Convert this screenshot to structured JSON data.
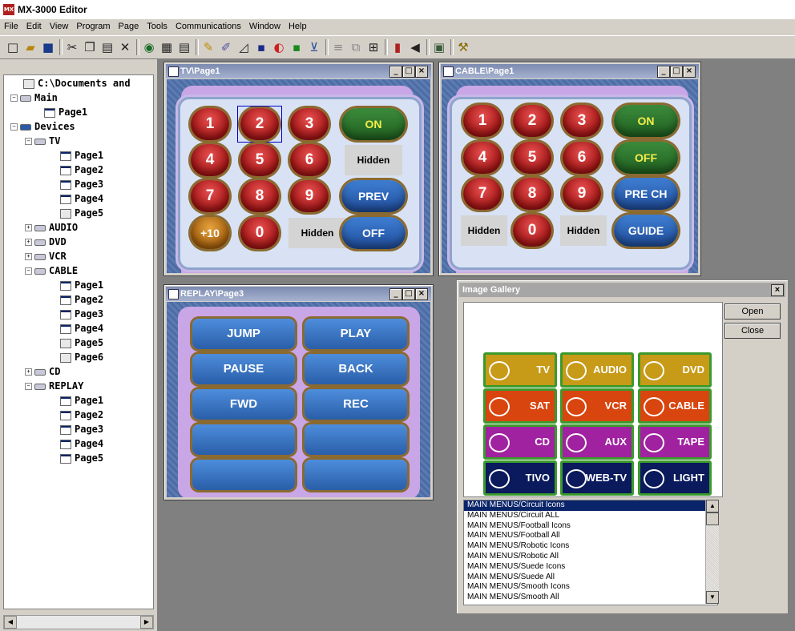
{
  "app": {
    "title": "MX-3000 Editor",
    "icon_text": "MX"
  },
  "menu": [
    "File",
    "Edit",
    "View",
    "Program",
    "Page",
    "Tools",
    "Communications",
    "Window",
    "Help"
  ],
  "tree": {
    "root": "C:\\Documents and",
    "main": "Main",
    "main_page": "Page1",
    "devices": "Devices",
    "tv": "TV",
    "tv_pages": [
      "Page1",
      "Page2",
      "Page3",
      "Page4",
      "Page5"
    ],
    "audio": "AUDIO",
    "dvd": "DVD",
    "vcr": "VCR",
    "cable": "CABLE",
    "cable_pages": [
      "Page1",
      "Page2",
      "Page3",
      "Page4",
      "Page5",
      "Page6"
    ],
    "cd": "CD",
    "replay": "REPLAY",
    "replay_pages": [
      "Page1",
      "Page2",
      "Page3",
      "Page4",
      "Page5"
    ]
  },
  "tv_window": {
    "title": "TV\\Page1",
    "buttons": [
      "1",
      "2",
      "3",
      "ON",
      "4",
      "5",
      "6",
      "Hidden",
      "7",
      "8",
      "9",
      "PREV",
      "+10",
      "0",
      "Hidden",
      "OFF"
    ]
  },
  "cable_window": {
    "title": "CABLE\\Page1",
    "buttons": [
      "1",
      "2",
      "3",
      "ON",
      "4",
      "5",
      "6",
      "OFF",
      "7",
      "8",
      "9",
      "PRE CH",
      "Hidden",
      "0",
      "Hidden",
      "GUIDE"
    ]
  },
  "replay_window": {
    "title": "REPLAY\\Page3",
    "buttons": [
      "JUMP",
      "PLAY",
      "PAUSE",
      "BACK",
      "FWD",
      "REC",
      "",
      "",
      "",
      ""
    ]
  },
  "gallery": {
    "title": "Image Gallery",
    "open": "Open",
    "close": "Close",
    "tiles": [
      "TV",
      "AUDIO",
      "DVD",
      "SAT",
      "VCR",
      "CABLE",
      "CD",
      "AUX",
      "TAPE",
      "TIVO",
      "WEB-TV",
      "LIGHT"
    ],
    "tile_colors": [
      "#c79a17",
      "#c79a17",
      "#c79a17",
      "#d8450e",
      "#d8450e",
      "#d8450e",
      "#a022a0",
      "#a022a0",
      "#a022a0",
      "#0a1a5c",
      "#0a1a5c",
      "#0a1a5c"
    ],
    "list": [
      "MAIN MENUS/Circuit Icons",
      "MAIN MENUS/Circuit ALL",
      "MAIN MENUS/Football Icons",
      "MAIN MENUS/Football All",
      "MAIN MENUS/Robotic Icons",
      "MAIN MENUS/Robotic All",
      "MAIN MENUS/Suede Icons",
      "MAIN MENUS/Suede All",
      "MAIN MENUS/Smooth Icons",
      "MAIN MENUS/Smooth All"
    ]
  }
}
